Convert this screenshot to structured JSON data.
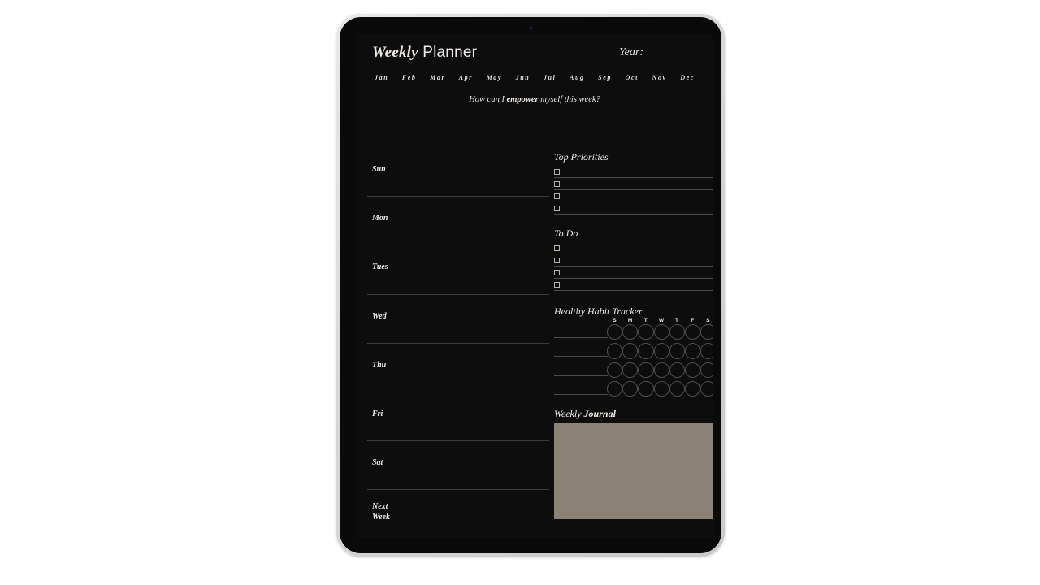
{
  "device": {
    "type": "tablet",
    "frame_color": "#d8d8da",
    "bezel_color": "#0a0a0a",
    "camera_name": "front-camera-dot"
  },
  "page": {
    "background": "#0d0d0d",
    "text_color": "#efeae2",
    "rule_color": "#3a3a3a"
  },
  "header": {
    "title_bold": "Weekly",
    "title_light": " Planner",
    "year_label": "Year:",
    "months": [
      "Jan",
      "Feb",
      "Mar",
      "Apr",
      "May",
      "Jun",
      "Jul",
      "Aug",
      "Sep",
      "Oct",
      "Nov",
      "Dec"
    ],
    "prompt_before": "How can I ",
    "prompt_bold": "empower",
    "prompt_after": " myself this week?"
  },
  "days": [
    {
      "label": "Sun"
    },
    {
      "label": "Mon"
    },
    {
      "label": "Tues"
    },
    {
      "label": "Wed"
    },
    {
      "label": "Thu"
    },
    {
      "label": "Fri"
    },
    {
      "label": "Sat"
    },
    {
      "label_line1": "Next",
      "label_line2": "Week"
    }
  ],
  "top_priorities": {
    "title": "Top Priorities",
    "rows": 4,
    "values": [
      "",
      "",
      "",
      ""
    ]
  },
  "to_do": {
    "title": "To Do",
    "rows": 4,
    "values": [
      "",
      "",
      "",
      ""
    ]
  },
  "habit_tracker": {
    "title": "Healthy Habit Tracker",
    "day_headers": [
      "S",
      "M",
      "T",
      "W",
      "T",
      "F",
      "S"
    ],
    "rows": 4,
    "habit_names": [
      "",
      "",
      "",
      ""
    ],
    "circle_color": "#4e4e4c"
  },
  "journal": {
    "title_light": "Weekly ",
    "title_bold": "Journal",
    "box_color": "#8b8275",
    "content": ""
  }
}
